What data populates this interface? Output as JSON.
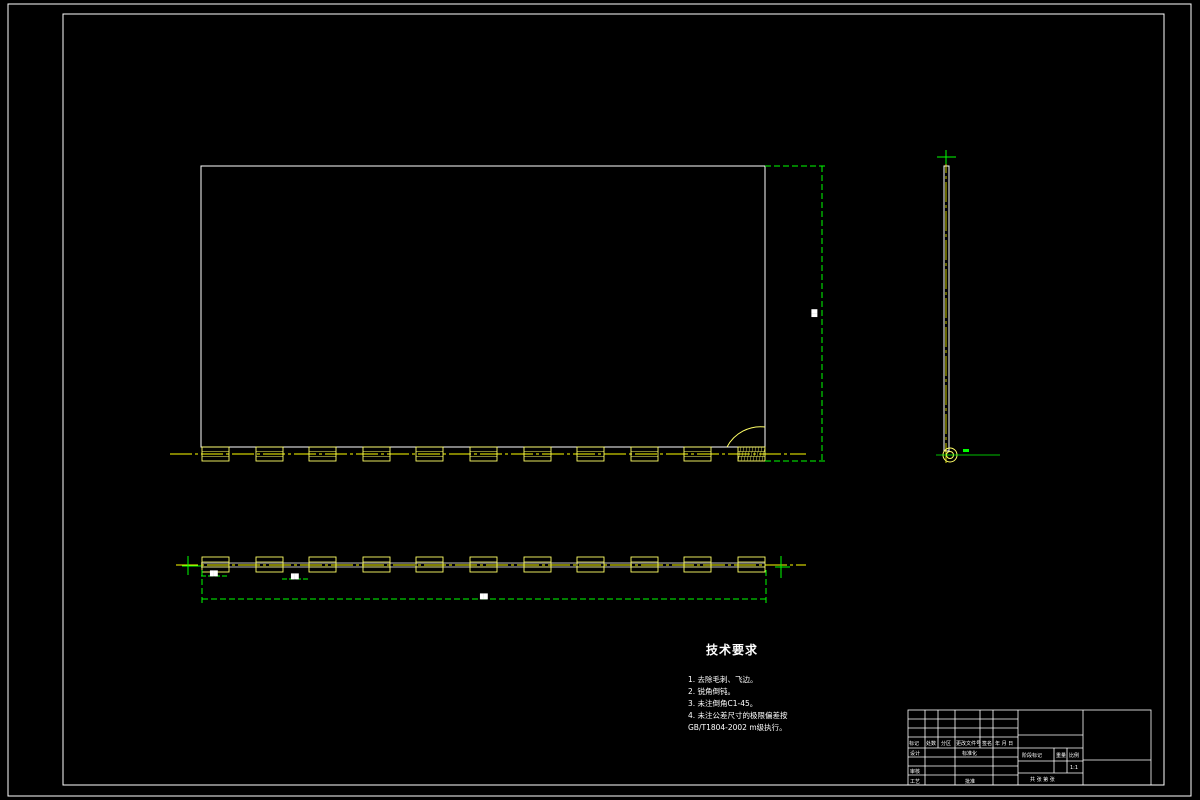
{
  "drawing": {
    "colors": {
      "background": "#000000",
      "outline": "#ffffff",
      "part": "#ffff66",
      "dimension": "#00ff00",
      "centerline": "#ffff00"
    },
    "dimensions": {
      "height_label": "██",
      "total_length_label": "██",
      "pitch_label": "██",
      "end_offset_label": "██"
    },
    "hinge_count": 11
  },
  "technical_requirements": {
    "title": "技术要求",
    "items": [
      "1. 去除毛刺、飞边。",
      "2. 锐角倒钝。",
      "3. 未注倒角C1-45。",
      "4. 未注公差尺寸的极限偏差按",
      "GB/T1804-2002 m级执行。"
    ]
  },
  "title_block": {
    "part_name": "",
    "material": "",
    "scale": "1:1",
    "labels": {
      "mark": "标记",
      "count": "处数",
      "zone": "分区",
      "doc_no": "更改文件号",
      "sign": "签名",
      "date": "年 月 日",
      "design": "设计",
      "standard": "标准化",
      "stage": "阶段标记",
      "weight": "重量",
      "ratio": "比例",
      "review": "审核",
      "craft": "工艺",
      "approve": "批准",
      "sheet": "共 张 第 张"
    }
  }
}
